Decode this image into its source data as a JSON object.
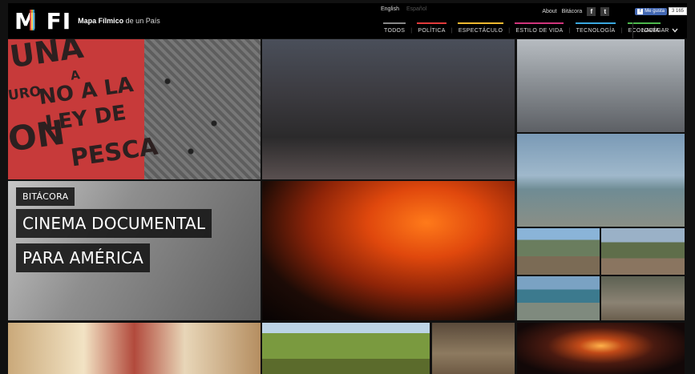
{
  "header": {
    "logo": "M FI",
    "tagline_bold": "Mapa Fílmico",
    "tagline_rest": " de un País",
    "languages": [
      {
        "label": "English",
        "active": true
      },
      {
        "label": "Español",
        "active": false
      }
    ],
    "links": [
      "About",
      "Bitácora"
    ],
    "social": [
      {
        "icon": "facebook-icon",
        "glyph": "f"
      },
      {
        "icon": "twitter-icon",
        "glyph": "t"
      }
    ],
    "like": {
      "label": "Me gusta",
      "count": "3 165"
    },
    "nav": [
      {
        "label": "TODOS",
        "color": "#888888"
      },
      {
        "label": "POLÍTICA",
        "color": "#e23b3b"
      },
      {
        "label": "ESPECTÁCULO",
        "color": "#f1b92f"
      },
      {
        "label": "ESTILO DE VIDA",
        "color": "#d0347c"
      },
      {
        "label": "TECNOLOGÍA",
        "color": "#3aa7e0"
      },
      {
        "label": "ECOLOGÍA",
        "color": "#4cb84c"
      }
    ],
    "navegar": "NAVEGAR"
  },
  "feature": {
    "category": "BITÁCORA",
    "title_line1": "CINEMA DOCUMENTAL",
    "title_line2": "PARA AMÉRICA"
  },
  "protest_banner": [
    "UNA",
    "A",
    "NO A LA",
    "LEY DE",
    "PESCA",
    "URO",
    "ON"
  ]
}
